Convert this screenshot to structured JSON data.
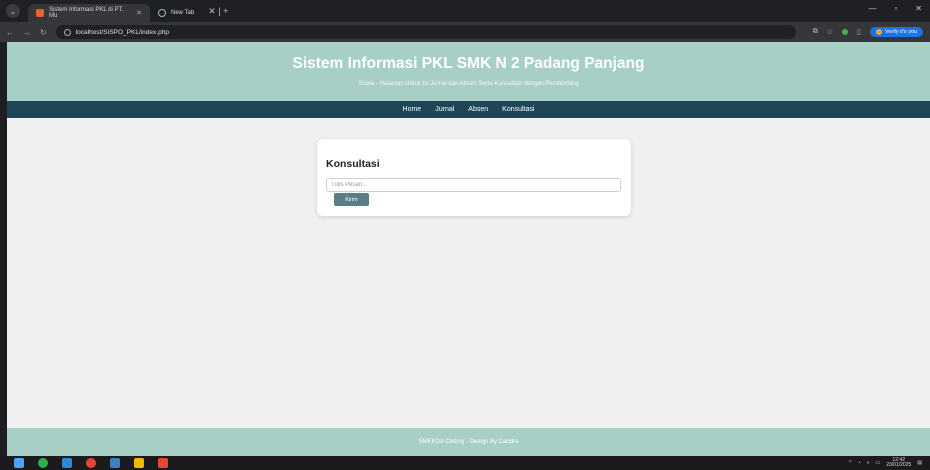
{
  "browser": {
    "tabs": [
      {
        "label": "Sistem Informasi PKL di PT. Mu",
        "active": true
      },
      {
        "label": "New Tab",
        "active": false
      }
    ],
    "url": "localhost/SISPO_PKL/index.php",
    "verify_label": "Verify it's you"
  },
  "header": {
    "title": "Sistem Informasi PKL SMK N 2 Padang Panjang",
    "subtitle": "Siswa - Halaman Untuk Isi Jurnal dan Absen Serta Konsultasi dengan Pembimbing"
  },
  "nav": {
    "items": [
      "Home",
      "Jurnal",
      "Absen",
      "Konsultasi"
    ]
  },
  "form": {
    "heading": "Konsultasi",
    "placeholder": "Tulis Pesan...",
    "button": "Kirim"
  },
  "footer": {
    "text": "SMEKDA Coding - Design By Candra"
  },
  "taskbar": {
    "time": "12:42",
    "date": "23/01/2025"
  },
  "colors": {
    "header_bg": "#a8cfc5",
    "nav_bg": "#1f4656",
    "button_bg": "#5a7e88",
    "page_bg": "#f0f0f0"
  }
}
